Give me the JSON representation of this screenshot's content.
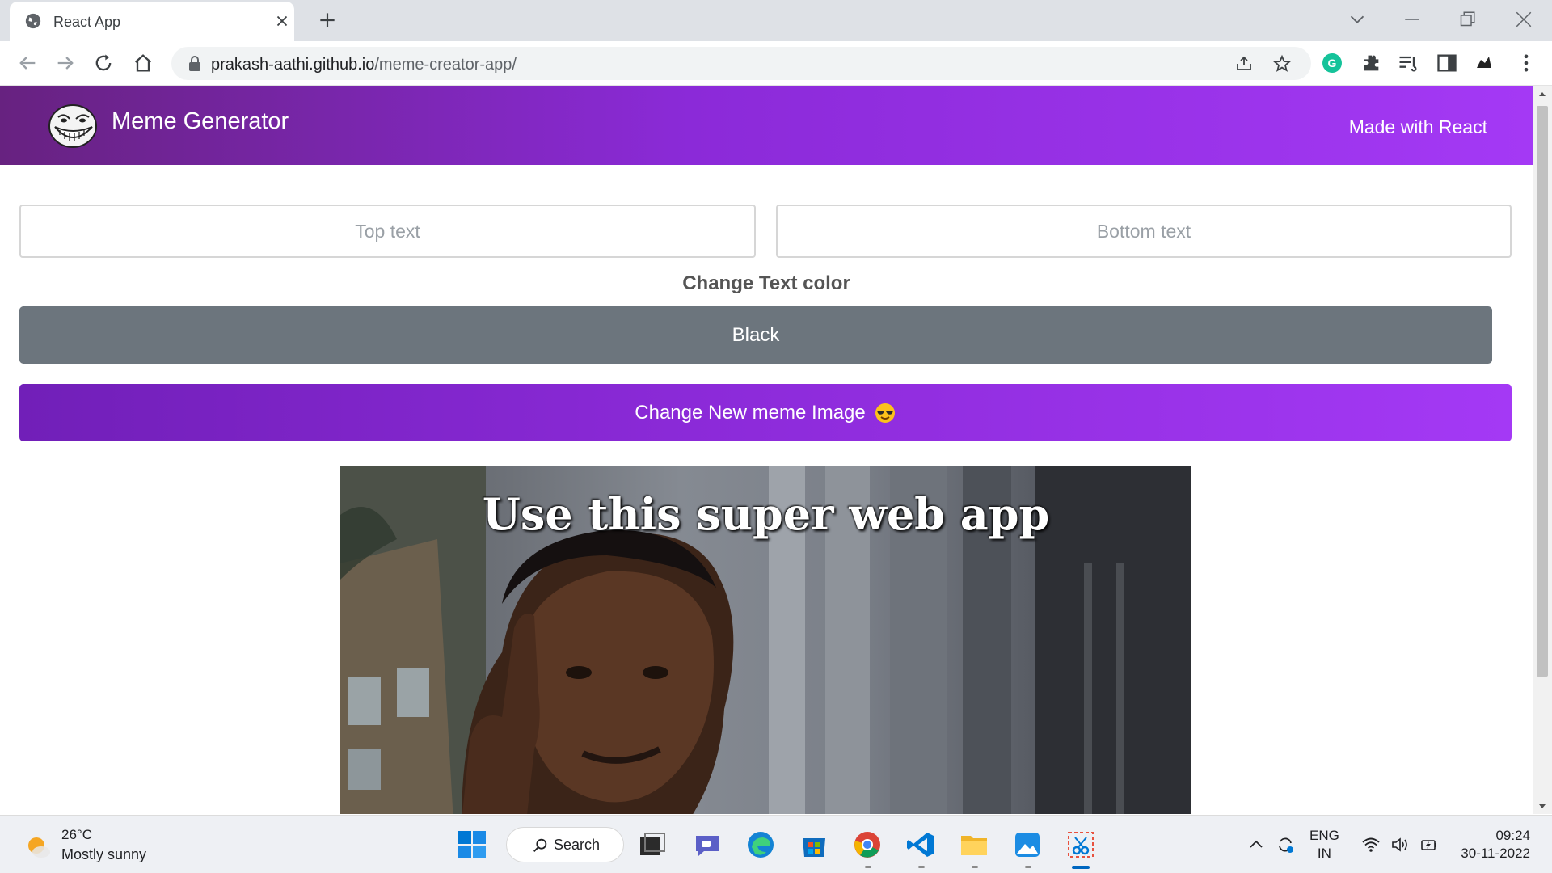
{
  "browser": {
    "tab_title": "React App",
    "url_host": "prakash-aathi.github.io",
    "url_path": "/meme-creator-app/"
  },
  "app": {
    "title": "Meme Generator",
    "header_right": "Made with React"
  },
  "form": {
    "top_text": {
      "value": "",
      "placeholder": "Top text"
    },
    "bottom_text": {
      "value": "",
      "placeholder": "Bottom text"
    },
    "color_label": "Change Text color",
    "color_button": "Black",
    "new_meme_button": "Change New meme Image"
  },
  "meme": {
    "top_caption": "Use this super web app",
    "bottom_caption": ""
  },
  "taskbar": {
    "weather_temp": "26°C",
    "weather_desc": "Mostly sunny",
    "search_label": "Search",
    "lang_line1": "ENG",
    "lang_line2": "IN",
    "time": "09:24",
    "date": "30-11-2022"
  },
  "colors": {
    "header_gradient_start": "#672280",
    "header_gradient_end": "#a439f5",
    "color_button_bg": "#6c757d",
    "caption_color": "#ffffff"
  }
}
